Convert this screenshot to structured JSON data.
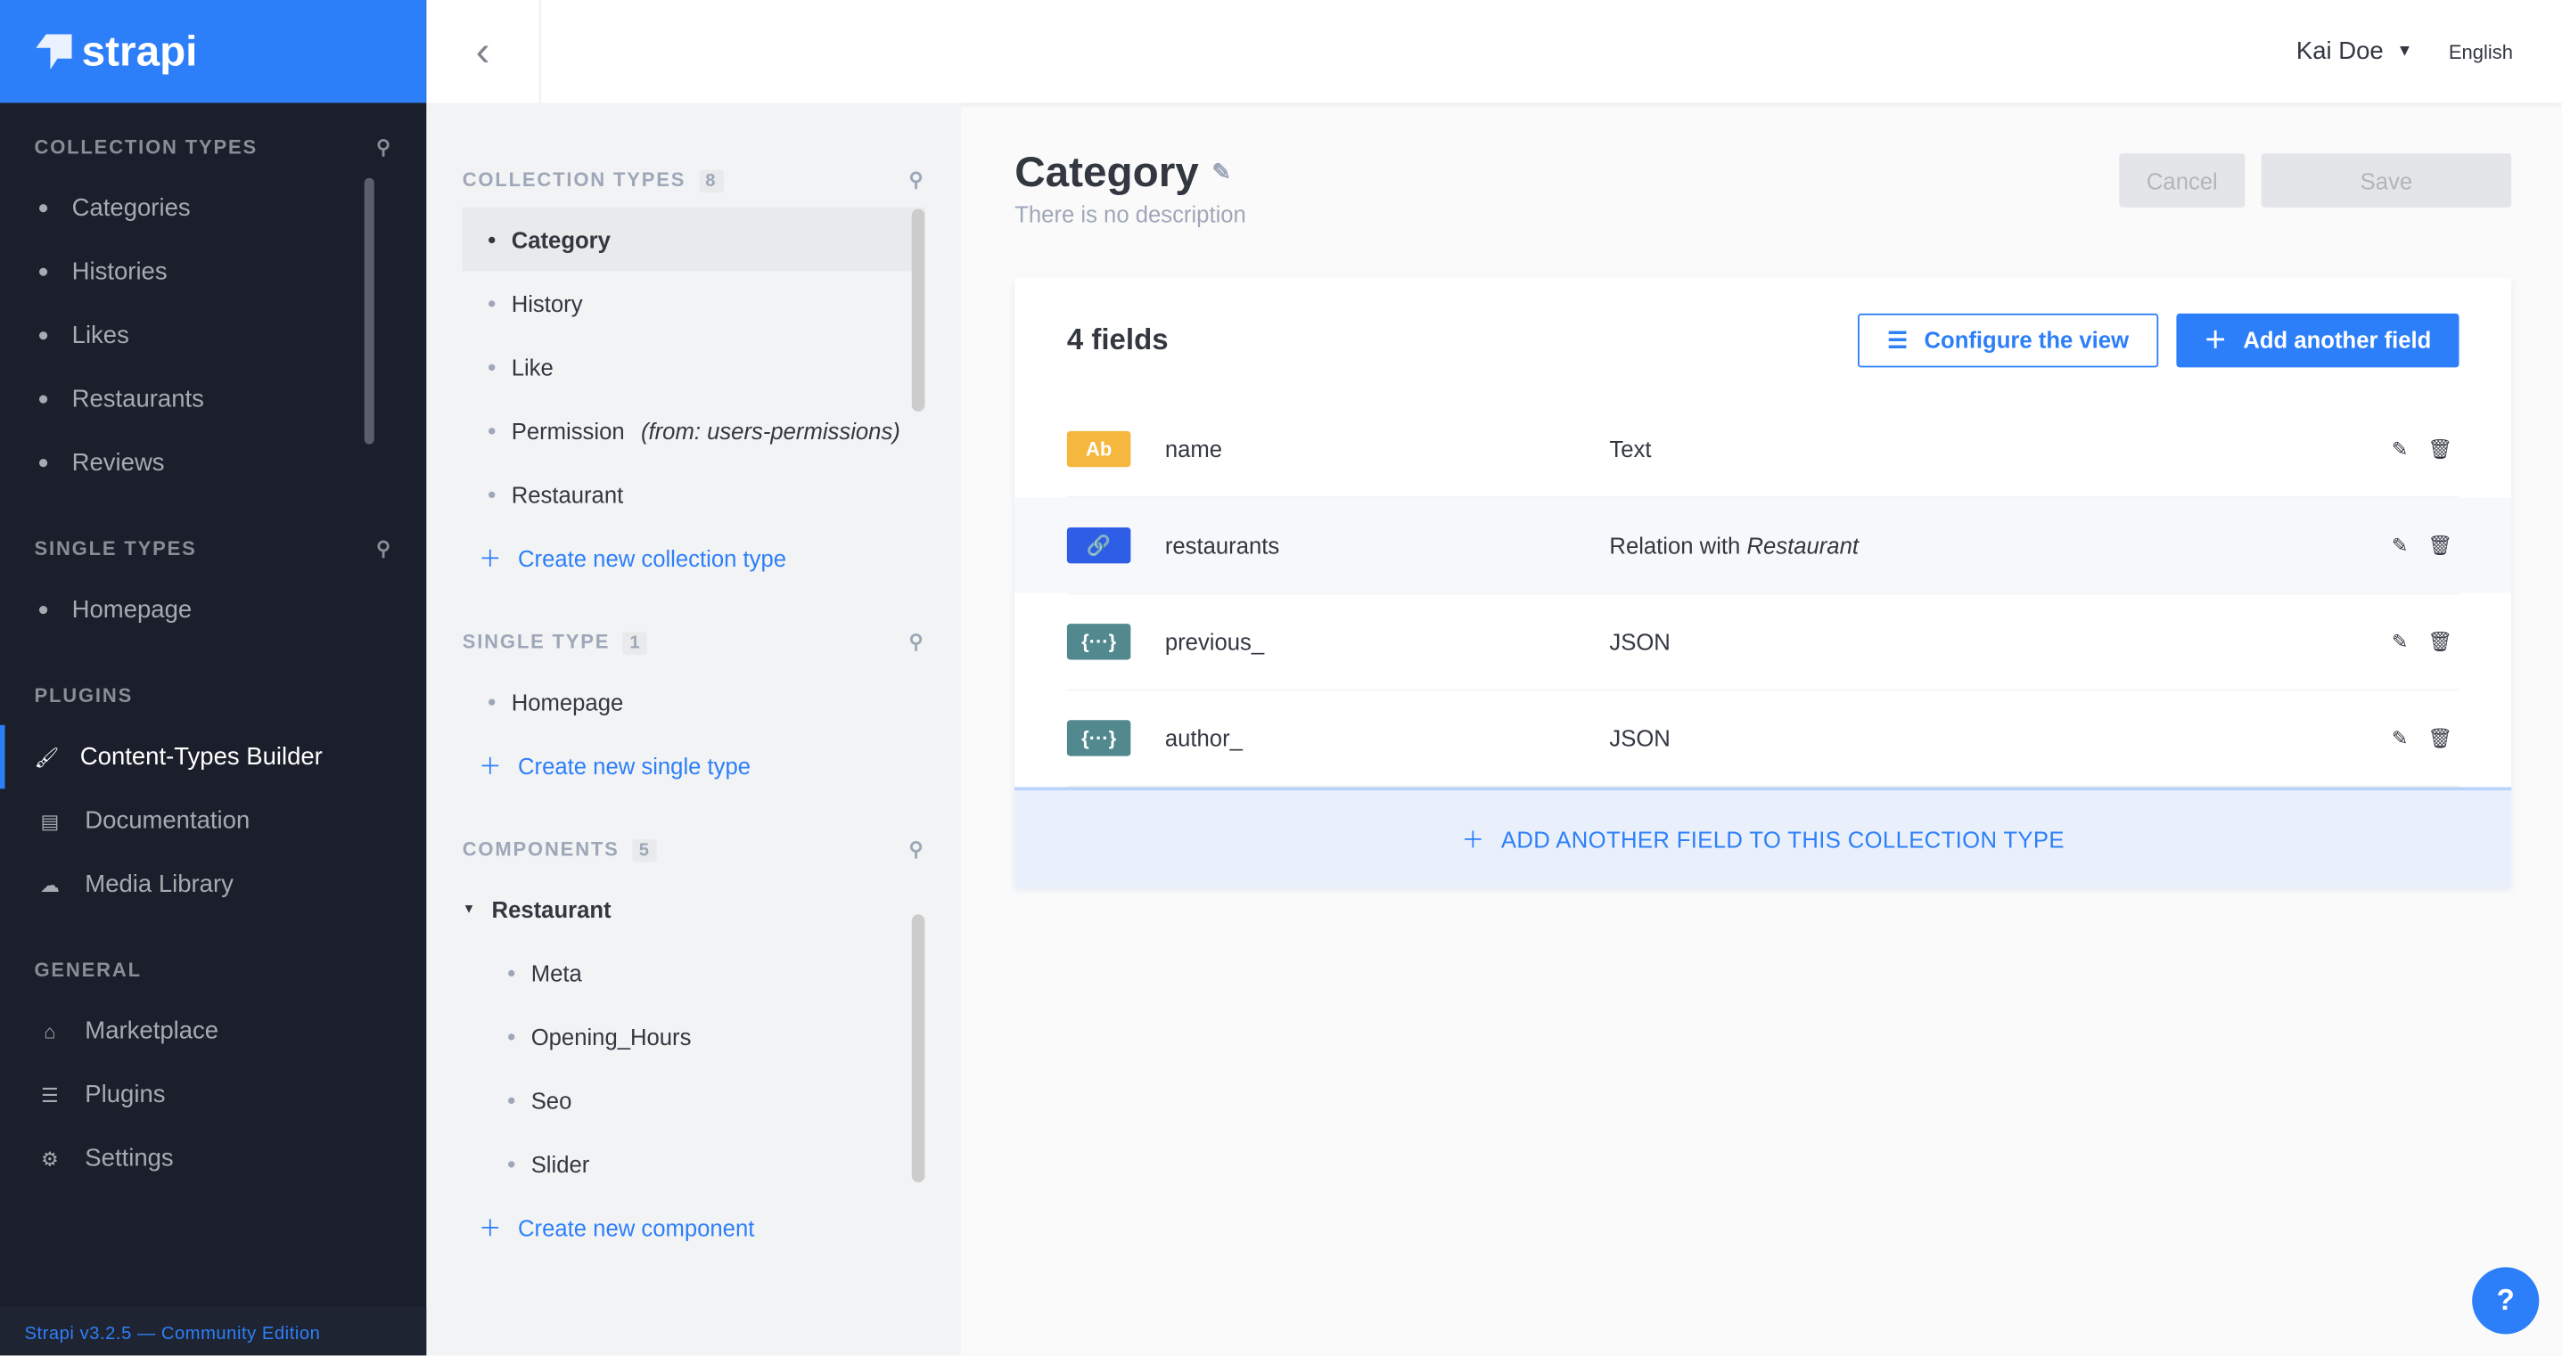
{
  "brand": {
    "name": "strapi",
    "color": "#2d7ff9"
  },
  "left_nav": {
    "collection_title": "COLLECTION TYPES",
    "collection_items": [
      "Categories",
      "Histories",
      "Likes",
      "Restaurants",
      "Reviews"
    ],
    "single_title": "SINGLE TYPES",
    "single_items": [
      "Homepage"
    ],
    "plugins_title": "PLUGINS",
    "plugins": [
      {
        "label": "Content-Types Builder",
        "icon": "paintbrush-icon"
      },
      {
        "label": "Documentation",
        "icon": "book-icon"
      },
      {
        "label": "Media Library",
        "icon": "cloud-upload-icon"
      }
    ],
    "general_title": "GENERAL",
    "general": [
      {
        "label": "Marketplace",
        "icon": "basket-icon"
      },
      {
        "label": "Plugins",
        "icon": "list-icon"
      },
      {
        "label": "Settings",
        "icon": "gear-icon"
      }
    ],
    "footer": "Strapi v3.2.5 — Community Edition"
  },
  "header": {
    "user": "Kai Doe",
    "language": "English"
  },
  "builder_nav": {
    "collection_title": "COLLECTION TYPES",
    "collection_count": "8",
    "collection_items": [
      "Category",
      "History",
      "Like",
      "Permission",
      "Restaurant"
    ],
    "permission_note": "(from: users-permissions)",
    "create_collection": "Create new collection type",
    "single_title": "SINGLE TYPE",
    "single_count": "1",
    "single_items": [
      "Homepage"
    ],
    "create_single": "Create new single type",
    "components_title": "COMPONENTS",
    "components_count": "5",
    "component_group": "Restaurant",
    "components": [
      "Meta",
      "Opening_Hours",
      "Seo",
      "Slider"
    ],
    "create_component": "Create new component"
  },
  "main": {
    "title": "Category",
    "description": "There is no description",
    "cancel": "Cancel",
    "save": "Save",
    "fields_count": "4 fields",
    "configure": "Configure the view",
    "add_field": "Add another field",
    "fields": [
      {
        "icon": "Ab",
        "name": "name",
        "type": "Text",
        "type_em": "",
        "color": "#f6b73f"
      },
      {
        "icon": "🔗",
        "name": "restaurants",
        "type": "Relation with ",
        "type_em": "Restaurant",
        "color": "#2e5ee5"
      },
      {
        "icon": "{···}",
        "name": "previous_",
        "type": "JSON",
        "type_em": "",
        "color": "#51898f"
      },
      {
        "icon": "{···}",
        "name": "author_",
        "type": "JSON",
        "type_em": "",
        "color": "#51898f"
      }
    ],
    "add_bottom": "ADD ANOTHER FIELD TO THIS COLLECTION TYPE"
  },
  "help": "?"
}
